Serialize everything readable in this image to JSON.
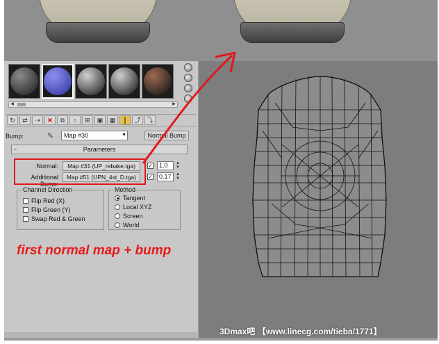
{
  "material_editor": {
    "slots": [
      {
        "name": "slot-1",
        "color_a": "#8a8a8a",
        "color_b": "#2a2a2a",
        "selected": false
      },
      {
        "name": "slot-2",
        "color_a": "#8f8ff0",
        "color_b": "#3a3fa8",
        "selected": true
      },
      {
        "name": "slot-3",
        "color_a": "#d0d0d0",
        "color_b": "#303030",
        "selected": false
      },
      {
        "name": "slot-4",
        "color_a": "#cfcfcf",
        "color_b": "#2b2b2b",
        "selected": false
      },
      {
        "name": "slot-5",
        "color_a": "#a06a50",
        "color_b": "#1e1e1e",
        "selected": false
      }
    ],
    "bump_label": "Bump:",
    "bump_map": "Map #30",
    "bump_type_button": "Normal Bump",
    "parameters_title": "Parameters",
    "parameters_collapse": "-",
    "normal_label": "Normal:",
    "normal_map": "Map #31 (UP_rebake.tga)",
    "normal_enabled": true,
    "normal_amount": "1.0",
    "additional_bump_label": "Additional Bump:",
    "additional_bump_map": "Map #51 (UPN_4st_D.tga)",
    "additional_bump_enabled": true,
    "additional_bump_amount": "0.17",
    "channel_direction": {
      "title": "Channel Direction",
      "options": [
        "Flip Red (X)",
        "Flip Green (Y)",
        "Swap Red & Green"
      ]
    },
    "method": {
      "title": "Method",
      "options": [
        "Tangent",
        "Local XYZ",
        "Screen",
        "World"
      ],
      "selected": "Tangent"
    }
  },
  "caption": "first normal map + bump",
  "watermark": "3Dmax吧 【www.linecg.com/tieba/1771】",
  "colors": {
    "annotation_red": "#e0191b",
    "panel_bg": "#c8c8c8",
    "viewport_bg": "#7d7d7d"
  }
}
